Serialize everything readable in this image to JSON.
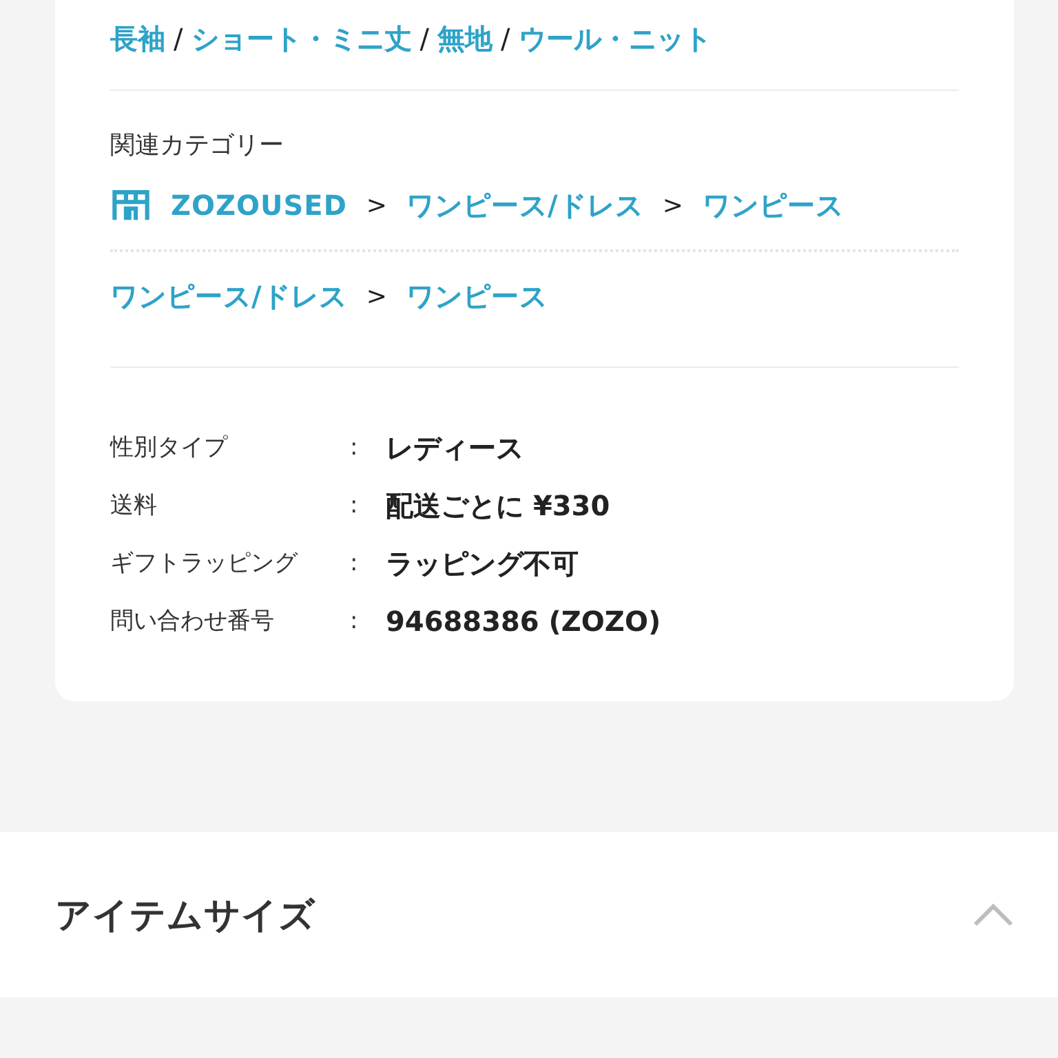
{
  "tags": {
    "separator": "/",
    "items": [
      "長袖",
      "ショート・ミニ丈",
      "無地",
      "ウール・ニット"
    ]
  },
  "related_categories": {
    "label": "関連カテゴリー",
    "separator": ">",
    "paths": [
      {
        "kind": "shop",
        "items": [
          "ZOZOUSED",
          "ワンピース/ドレス",
          "ワンピース"
        ]
      },
      {
        "kind": "plain",
        "items": [
          "ワンピース/ドレス",
          "ワンピース"
        ]
      }
    ]
  },
  "specs": {
    "colon": ":",
    "rows": [
      {
        "label": "性別タイプ",
        "value": "レディース"
      },
      {
        "label": "送料",
        "value": "配送ごとに ¥330"
      },
      {
        "label": "ギフトラッピング",
        "value": "ラッピング不可"
      },
      {
        "label": "問い合わせ番号",
        "value": "94688386 (ZOZO)"
      }
    ]
  },
  "item_size": {
    "title": "アイテムサイズ",
    "expanded": true
  }
}
